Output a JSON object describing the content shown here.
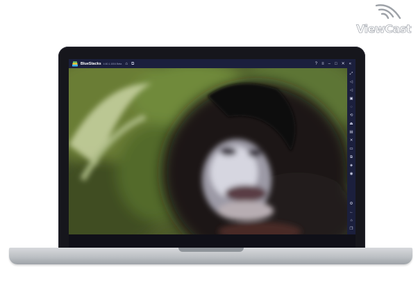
{
  "watermark": {
    "text": "ViewCast"
  },
  "app": {
    "title": "BlueStacks",
    "version": "4.60.1.1004 Beta"
  },
  "titlebar_icons": {
    "left": [
      "home-icon",
      "multi-instance-icon"
    ],
    "right": [
      "help-icon",
      "menu-icon",
      "minimize-icon",
      "maximize-icon",
      "close-icon",
      "collapse-icon"
    ]
  },
  "sidebar_buttons": [
    "fullscreen",
    "volume-up",
    "volume-down",
    "keymapping",
    "record",
    "rotate",
    "install-apk",
    "screenshot",
    "shake",
    "folder",
    "copy",
    "layers",
    "macro"
  ],
  "sidebar_bottom": [
    "settings",
    "back",
    "home",
    "recents"
  ],
  "colors": {
    "titlebar": "#1b1f3d",
    "bezel": "#16161c",
    "base": "#c7cacd"
  }
}
